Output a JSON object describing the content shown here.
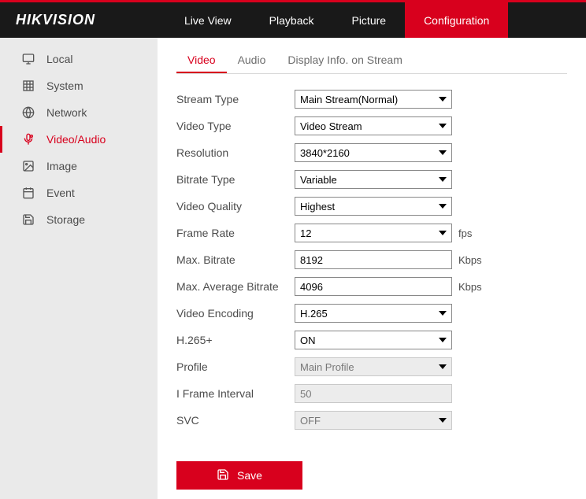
{
  "logo": {
    "text": "HIKVISION"
  },
  "nav": [
    {
      "label": "Live View",
      "active": false
    },
    {
      "label": "Playback",
      "active": false
    },
    {
      "label": "Picture",
      "active": false
    },
    {
      "label": "Configuration",
      "active": true
    }
  ],
  "sidebar": [
    {
      "label": "Local",
      "icon": "monitor-icon",
      "active": false
    },
    {
      "label": "System",
      "icon": "grid-icon",
      "active": false
    },
    {
      "label": "Network",
      "icon": "globe-icon",
      "active": false
    },
    {
      "label": "Video/Audio",
      "icon": "mic-icon",
      "active": true
    },
    {
      "label": "Image",
      "icon": "image-icon",
      "active": false
    },
    {
      "label": "Event",
      "icon": "calendar-icon",
      "active": false
    },
    {
      "label": "Storage",
      "icon": "save-icon",
      "active": false
    }
  ],
  "tabs": [
    {
      "label": "Video",
      "active": true
    },
    {
      "label": "Audio",
      "active": false
    },
    {
      "label": "Display Info. on Stream",
      "active": false
    }
  ],
  "fields": [
    {
      "label": "Stream Type",
      "type": "select",
      "value": "Main Stream(Normal)",
      "unit": "",
      "disabled": false
    },
    {
      "label": "Video Type",
      "type": "select",
      "value": "Video Stream",
      "unit": "",
      "disabled": false
    },
    {
      "label": "Resolution",
      "type": "select",
      "value": "3840*2160",
      "unit": "",
      "disabled": false
    },
    {
      "label": "Bitrate Type",
      "type": "select",
      "value": "Variable",
      "unit": "",
      "disabled": false
    },
    {
      "label": "Video Quality",
      "type": "select",
      "value": "Highest",
      "unit": "",
      "disabled": false
    },
    {
      "label": "Frame Rate",
      "type": "select",
      "value": "12",
      "unit": "fps",
      "disabled": false
    },
    {
      "label": "Max. Bitrate",
      "type": "input",
      "value": "8192",
      "unit": "Kbps",
      "disabled": false
    },
    {
      "label": "Max. Average Bitrate",
      "type": "input",
      "value": "4096",
      "unit": "Kbps",
      "disabled": false
    },
    {
      "label": "Video Encoding",
      "type": "select",
      "value": "H.265",
      "unit": "",
      "disabled": false
    },
    {
      "label": "H.265+",
      "type": "select",
      "value": "ON",
      "unit": "",
      "disabled": false
    },
    {
      "label": "Profile",
      "type": "select",
      "value": "Main Profile",
      "unit": "",
      "disabled": true
    },
    {
      "label": "I Frame Interval",
      "type": "input",
      "value": "50",
      "unit": "",
      "disabled": true
    },
    {
      "label": "SVC",
      "type": "select",
      "value": "OFF",
      "unit": "",
      "disabled": true
    }
  ],
  "saveLabel": "Save"
}
